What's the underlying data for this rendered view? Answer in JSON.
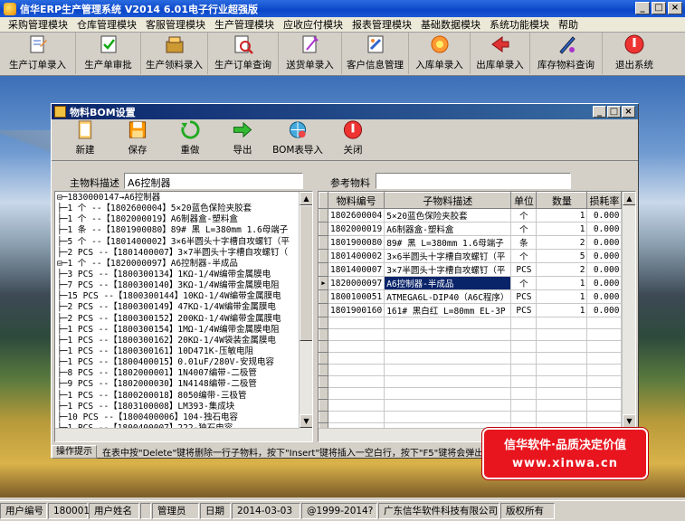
{
  "app": {
    "title": "信华ERP生产管理系统  V2014  6.01电子行业超强版",
    "min": "_",
    "max": "□",
    "close": "×"
  },
  "menu": [
    "采购管理模块",
    "仓库管理模块",
    "客服管理模块",
    "生产管理模块",
    "应收应付模块",
    "报表管理模块",
    "基础数据模块",
    "系统功能模块",
    "帮助"
  ],
  "toolbar": [
    {
      "label": "生产订单录入",
      "icon": "order-entry-icon"
    },
    {
      "label": "生产单审批",
      "icon": "approval-icon"
    },
    {
      "label": "生产领料录入",
      "icon": "material-pick-icon"
    },
    {
      "label": "生产订单查询",
      "icon": "order-query-icon"
    },
    {
      "label": "送货单录入",
      "icon": "delivery-icon"
    },
    {
      "label": "客户信息管理",
      "icon": "customer-icon"
    },
    {
      "label": "入库单录入",
      "icon": "stock-in-icon"
    },
    {
      "label": "出库单录入",
      "icon": "stock-out-icon"
    },
    {
      "label": "库存物料查询",
      "icon": "inventory-query-icon"
    },
    {
      "label": "退出系统",
      "icon": "exit-icon"
    }
  ],
  "dialog": {
    "title": "物料BOM设置",
    "buttons": [
      "新建",
      "保存",
      "重做",
      "导出",
      "BOM表导入",
      "关闭"
    ],
    "main_label": "主物料描述",
    "main_value": "A6控制器",
    "ref_label": "参考物料",
    "ref_value": "",
    "tree": [
      "⊟─1830000147→A6控制器",
      "   ├─1 个 --【1802600004】5×20蓝色保险夹胶套",
      "   ├─1 个 --【1802000019】A6制器盒-塑料盒",
      "   ├─1 条 --【1801900080】89#  黑 L=380mm 1.6母端子",
      "   ├─5 个 --【1801400002】3×6半圆头十字槽自攻螺钉（平",
      "   ├─2 PCS --【1801400007】3×7半圆头十字槽自攻螺钉（",
      "   ⊟─1 个 --【1820000097】A6控制器-半成品",
      "      ├─3 PCS --【1800300134】1KΩ-1/4W编带金属膜电",
      "      ├─7 PCS --【1800300140】3KΩ-1/4W编带金属膜电阻",
      "      ├─15 PCS --【1800300144】10KΩ-1/4W编带金属膜电",
      "      ├─2 PCS --【1800300149】47KΩ-1/4W编带金属膜电",
      "      ├─2 PCS --【1800300152】200KΩ-1/4W编带金属膜电",
      "      ├─1 PCS --【1800300154】1MΩ-1/4W编带金属膜电阻",
      "      ├─1 PCS --【1800300162】20KΩ-1/4W袋装金属膜电",
      "      ├─1 PCS --【1800300161】10D471K-压敏电阻",
      "      ├─1 PCS --【1800400015】0.01uF/280V-安规电容",
      "      ├─8 PCS --【1802000001】1N4007编带-二极管",
      "      ├─9 PCS --【1802000030】1N4148编带-二极管",
      "      ├─1 PCS --【1800200018】8050编带-三极管",
      "      ├─1 PCS --【1803100008】LM393-集成块",
      "      ├─10 PCS --【1800400006】104-独石电容",
      "      ├─1 PCS --【1800400007】222-独石电容"
    ],
    "grid": {
      "headers": [
        "物料编号",
        "子物料描述",
        "单位",
        "数量",
        "损耗率"
      ],
      "rows": [
        {
          "code": "1802600004",
          "desc": "5×20蓝色保险夹胶套",
          "unit": "个",
          "qty": "1",
          "loss": "0.000"
        },
        {
          "code": "1802000019",
          "desc": "A6制器盒-塑料盒",
          "unit": "个",
          "qty": "1",
          "loss": "0.000"
        },
        {
          "code": "1801900080",
          "desc": "89#  黑 L=380mm 1.6母端子",
          "unit": "条",
          "qty": "2",
          "loss": "0.000"
        },
        {
          "code": "1801400002",
          "desc": "3×6半圆头十字槽自攻螺钉（平",
          "unit": "个",
          "qty": "5",
          "loss": "0.000"
        },
        {
          "code": "1801400007",
          "desc": "3×7半圆头十字槽自攻螺钉（平",
          "unit": "PCS",
          "qty": "2",
          "loss": "0.000"
        },
        {
          "code": "1820000097",
          "desc": "A6控制器-半成品",
          "unit": "个",
          "qty": "1",
          "loss": "0.000"
        },
        {
          "code": "1800100051",
          "desc": "ATMEGA6L-DIP40（A6C程序）",
          "unit": "PCS",
          "qty": "1",
          "loss": "0.000"
        },
        {
          "code": "1801900160",
          "desc": "161#  黑白红 L=80mm EL-3P",
          "unit": "PCS",
          "qty": "1",
          "loss": "0.000"
        }
      ]
    },
    "hint_tab": "操作提示",
    "hint": "在表中按\"Delete\"键将删除一行子物料，按下\"Insert\"键将插入一空白行，按下\"F5\"键将会弹出子物料选"
  },
  "promo": {
    "line1": "信华软件·品质决定价值",
    "line2": "www.xinwa.cn"
  },
  "status": [
    {
      "label": "用户编号"
    },
    {
      "label": "180001"
    },
    {
      "label": "用户姓名"
    },
    {
      "label": ""
    },
    {
      "label": "管理员"
    },
    {
      "label": "日期"
    },
    {
      "label": "2014-03-03"
    },
    {
      "label": "@1999-2014?"
    },
    {
      "label": "广东信华软件科技有限公司"
    },
    {
      "label": "版权所有"
    }
  ]
}
